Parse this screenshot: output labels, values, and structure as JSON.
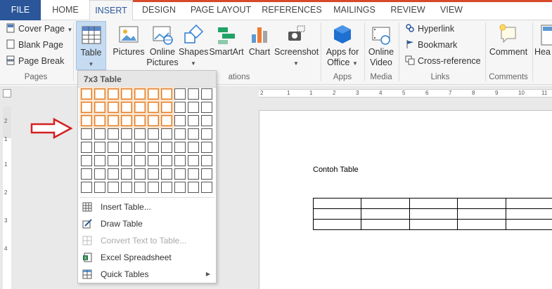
{
  "tabs": [
    {
      "label": "FILE"
    },
    {
      "label": "HOME"
    },
    {
      "label": "INSERT"
    },
    {
      "label": "DESIGN"
    },
    {
      "label": "PAGE LAYOUT"
    },
    {
      "label": "REFERENCES"
    },
    {
      "label": "MAILINGS"
    },
    {
      "label": "REVIEW"
    },
    {
      "label": "VIEW"
    }
  ],
  "ribbon": {
    "pages": {
      "label": "Pages",
      "cover_page": "Cover Page",
      "blank_page": "Blank Page",
      "page_break": "Page Break"
    },
    "table_button": "Table",
    "illustrations_label_fragment": "ations",
    "pictures": "Pictures",
    "online_pictures_line1": "Online",
    "online_pictures_line2": "Pictures",
    "shapes": "Shapes",
    "smartart": "SmartArt",
    "chart": "Chart",
    "screenshot": "Screenshot",
    "apps": {
      "label": "Apps",
      "apps_line1": "Apps for",
      "apps_line2": "Office"
    },
    "media": {
      "label": "Media",
      "video_line1": "Online",
      "video_line2": "Video"
    },
    "links": {
      "label": "Links",
      "hyperlink": "Hyperlink",
      "bookmark": "Bookmark",
      "cross_reference": "Cross-reference"
    },
    "comments": {
      "label": "Comments",
      "comment": "Comment"
    },
    "header_fragment": "Hea"
  },
  "table_dropdown": {
    "header": "7x3 Table",
    "grid_cols": 10,
    "grid_rows": 8,
    "selected_cols": 7,
    "selected_rows": 3,
    "items": [
      {
        "label": "Insert Table...",
        "icon": "insert-table-icon",
        "enabled": true
      },
      {
        "label": "Draw Table",
        "icon": "draw-table-icon",
        "enabled": true
      },
      {
        "label": "Convert Text to Table...",
        "icon": "convert-text-icon",
        "enabled": false
      },
      {
        "label": "Excel Spreadsheet",
        "icon": "excel-icon",
        "enabled": true
      },
      {
        "label": "Quick Tables",
        "icon": "quick-tables-icon",
        "enabled": true,
        "submenu": true
      }
    ]
  },
  "document": {
    "heading": "Contoh Table",
    "table_rows": 3,
    "table_cols": 5
  },
  "ruler": {
    "h_marks": [
      "2",
      "1",
      "1",
      "2",
      "3",
      "4",
      "5",
      "6",
      "7",
      "8",
      "9",
      "10",
      "11"
    ],
    "v_marks": [
      "2",
      "1",
      "1",
      "2",
      "3",
      "4"
    ]
  },
  "colors": {
    "file_tab": "#2b579a",
    "accent_line": "#d64a2b",
    "selection": "#e07b28",
    "arrow": "#d42020"
  }
}
